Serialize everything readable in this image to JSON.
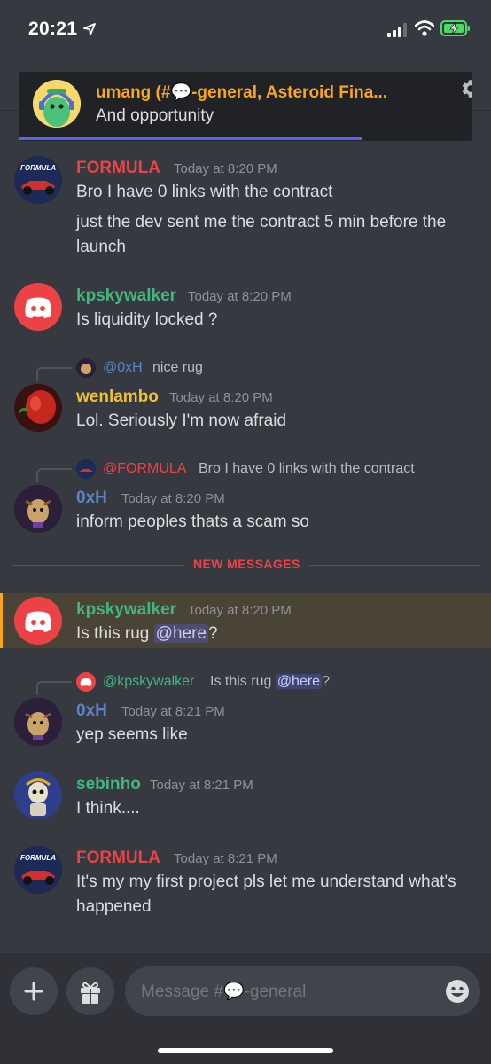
{
  "status_bar": {
    "time": "20:21"
  },
  "notification": {
    "title": "umang (#💬-general, Asteroid Fina...",
    "body": "And opportunity",
    "colors": {
      "title": "#faa61a",
      "progress": "#5865f2"
    }
  },
  "messages": [
    {
      "author": "FORMULA",
      "timestamp": "Today at 8:20 PM",
      "lines": [
        "Bro I have 0 links with the contract",
        "just the dev sent me the contract 5 min before the launch"
      ]
    },
    {
      "author": "kpskywalker",
      "timestamp": "Today at 8:20 PM",
      "lines": [
        "Is liquidity locked ?"
      ]
    },
    {
      "reply": {
        "author": "@0xH",
        "text": "nice rug"
      },
      "author": "wenlambo",
      "timestamp": "Today at 8:20 PM",
      "lines": [
        "Lol. Seriously I'm now afraid"
      ]
    },
    {
      "reply": {
        "author": "@FORMULA",
        "text": "Bro I have 0 links with the contract"
      },
      "author": "0xH",
      "timestamp": "Today at 8:20 PM",
      "lines": [
        "inform peoples thats a scam so"
      ]
    },
    {
      "author": "kpskywalker",
      "timestamp": "Today at 8:20 PM",
      "text_prefix": "Is this rug ",
      "mention": "@here",
      "text_suffix": "?"
    },
    {
      "reply": {
        "author": "@kpskywalker",
        "text_prefix": "Is this rug ",
        "mention": "@here",
        "text_suffix": "?"
      },
      "author": "0xH",
      "timestamp": "Today at 8:21 PM",
      "lines": [
        "yep seems like"
      ]
    },
    {
      "author": "sebinho",
      "timestamp": "Today at 8:21 PM",
      "lines": [
        "I think...."
      ]
    },
    {
      "author": "FORMULA",
      "timestamp": "Today at 8:21 PM",
      "lines": [
        "It's my my first project pls let me understand what's happened"
      ]
    }
  ],
  "new_messages_divider": "NEW MESSAGES",
  "composer": {
    "placeholder": "Message #💬-general"
  },
  "colors": {
    "background": "#36393f",
    "formula": "#ed4245",
    "kpskywalker": "#43b581",
    "wenlambo": "#f0c232",
    "oxh": "#5b84c4",
    "sebinho": "#43b581",
    "mention_bg": "#5865f2",
    "highlight": "#faa61a"
  },
  "icons": [
    "location-arrow-icon",
    "signal-icon",
    "wifi-icon",
    "battery-charging-icon",
    "gear-icon",
    "discord-logo-icon",
    "plus-icon",
    "gift-icon",
    "emoji-icon"
  ]
}
